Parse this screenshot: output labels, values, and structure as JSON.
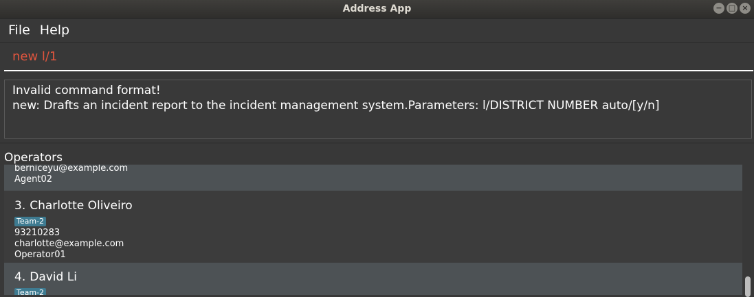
{
  "window": {
    "title": "Address App",
    "controls": {
      "minimize": "−",
      "maximize": "□",
      "close": "×"
    }
  },
  "menu": {
    "items": [
      "File",
      "Help"
    ]
  },
  "command": {
    "value": "new l/1"
  },
  "result": {
    "lines": [
      "Invalid command format!",
      "new: Drafts an incident report to the incident management system.Parameters: l/DISTRICT NUMBER auto/[y/n]"
    ]
  },
  "operators": {
    "title": "Operators",
    "partial_card": {
      "email": "berniceyu@example.com",
      "username": "Agent02"
    },
    "cards": [
      {
        "index": "3.",
        "name": "Charlotte Oliveiro",
        "tag": "Team-2",
        "phone": "93210283",
        "email": "charlotte@example.com",
        "username": "Operator01"
      },
      {
        "index": "4.",
        "name": "David Li",
        "tag": "Team-2"
      }
    ]
  },
  "colors": {
    "command_text": "#e0553e",
    "tag_bg": "#3e7b91",
    "card_light": "#4d5255",
    "card_dark": "#3c3c3c"
  }
}
